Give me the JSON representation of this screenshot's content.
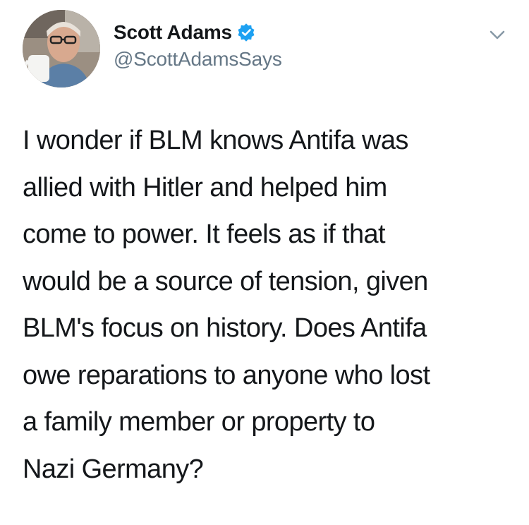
{
  "tweet": {
    "author": {
      "display_name": "Scott Adams",
      "handle": "@ScottAdamsSays",
      "verified": true,
      "avatar_icon": "profile-photo"
    },
    "menu_icon": "chevron-down-icon",
    "text": "I wonder if BLM knows Antifa was\nallied with Hitler and helped him\ncome to power. It feels as if that\nwould be a source of tension, given\nBLM's focus on history. Does Antifa\nowe reparations to anyone who lost\na family member or property to\nNazi Germany?"
  },
  "colors": {
    "text": "#14171a",
    "secondary": "#657786",
    "verified_badge": "#1da1f2"
  }
}
